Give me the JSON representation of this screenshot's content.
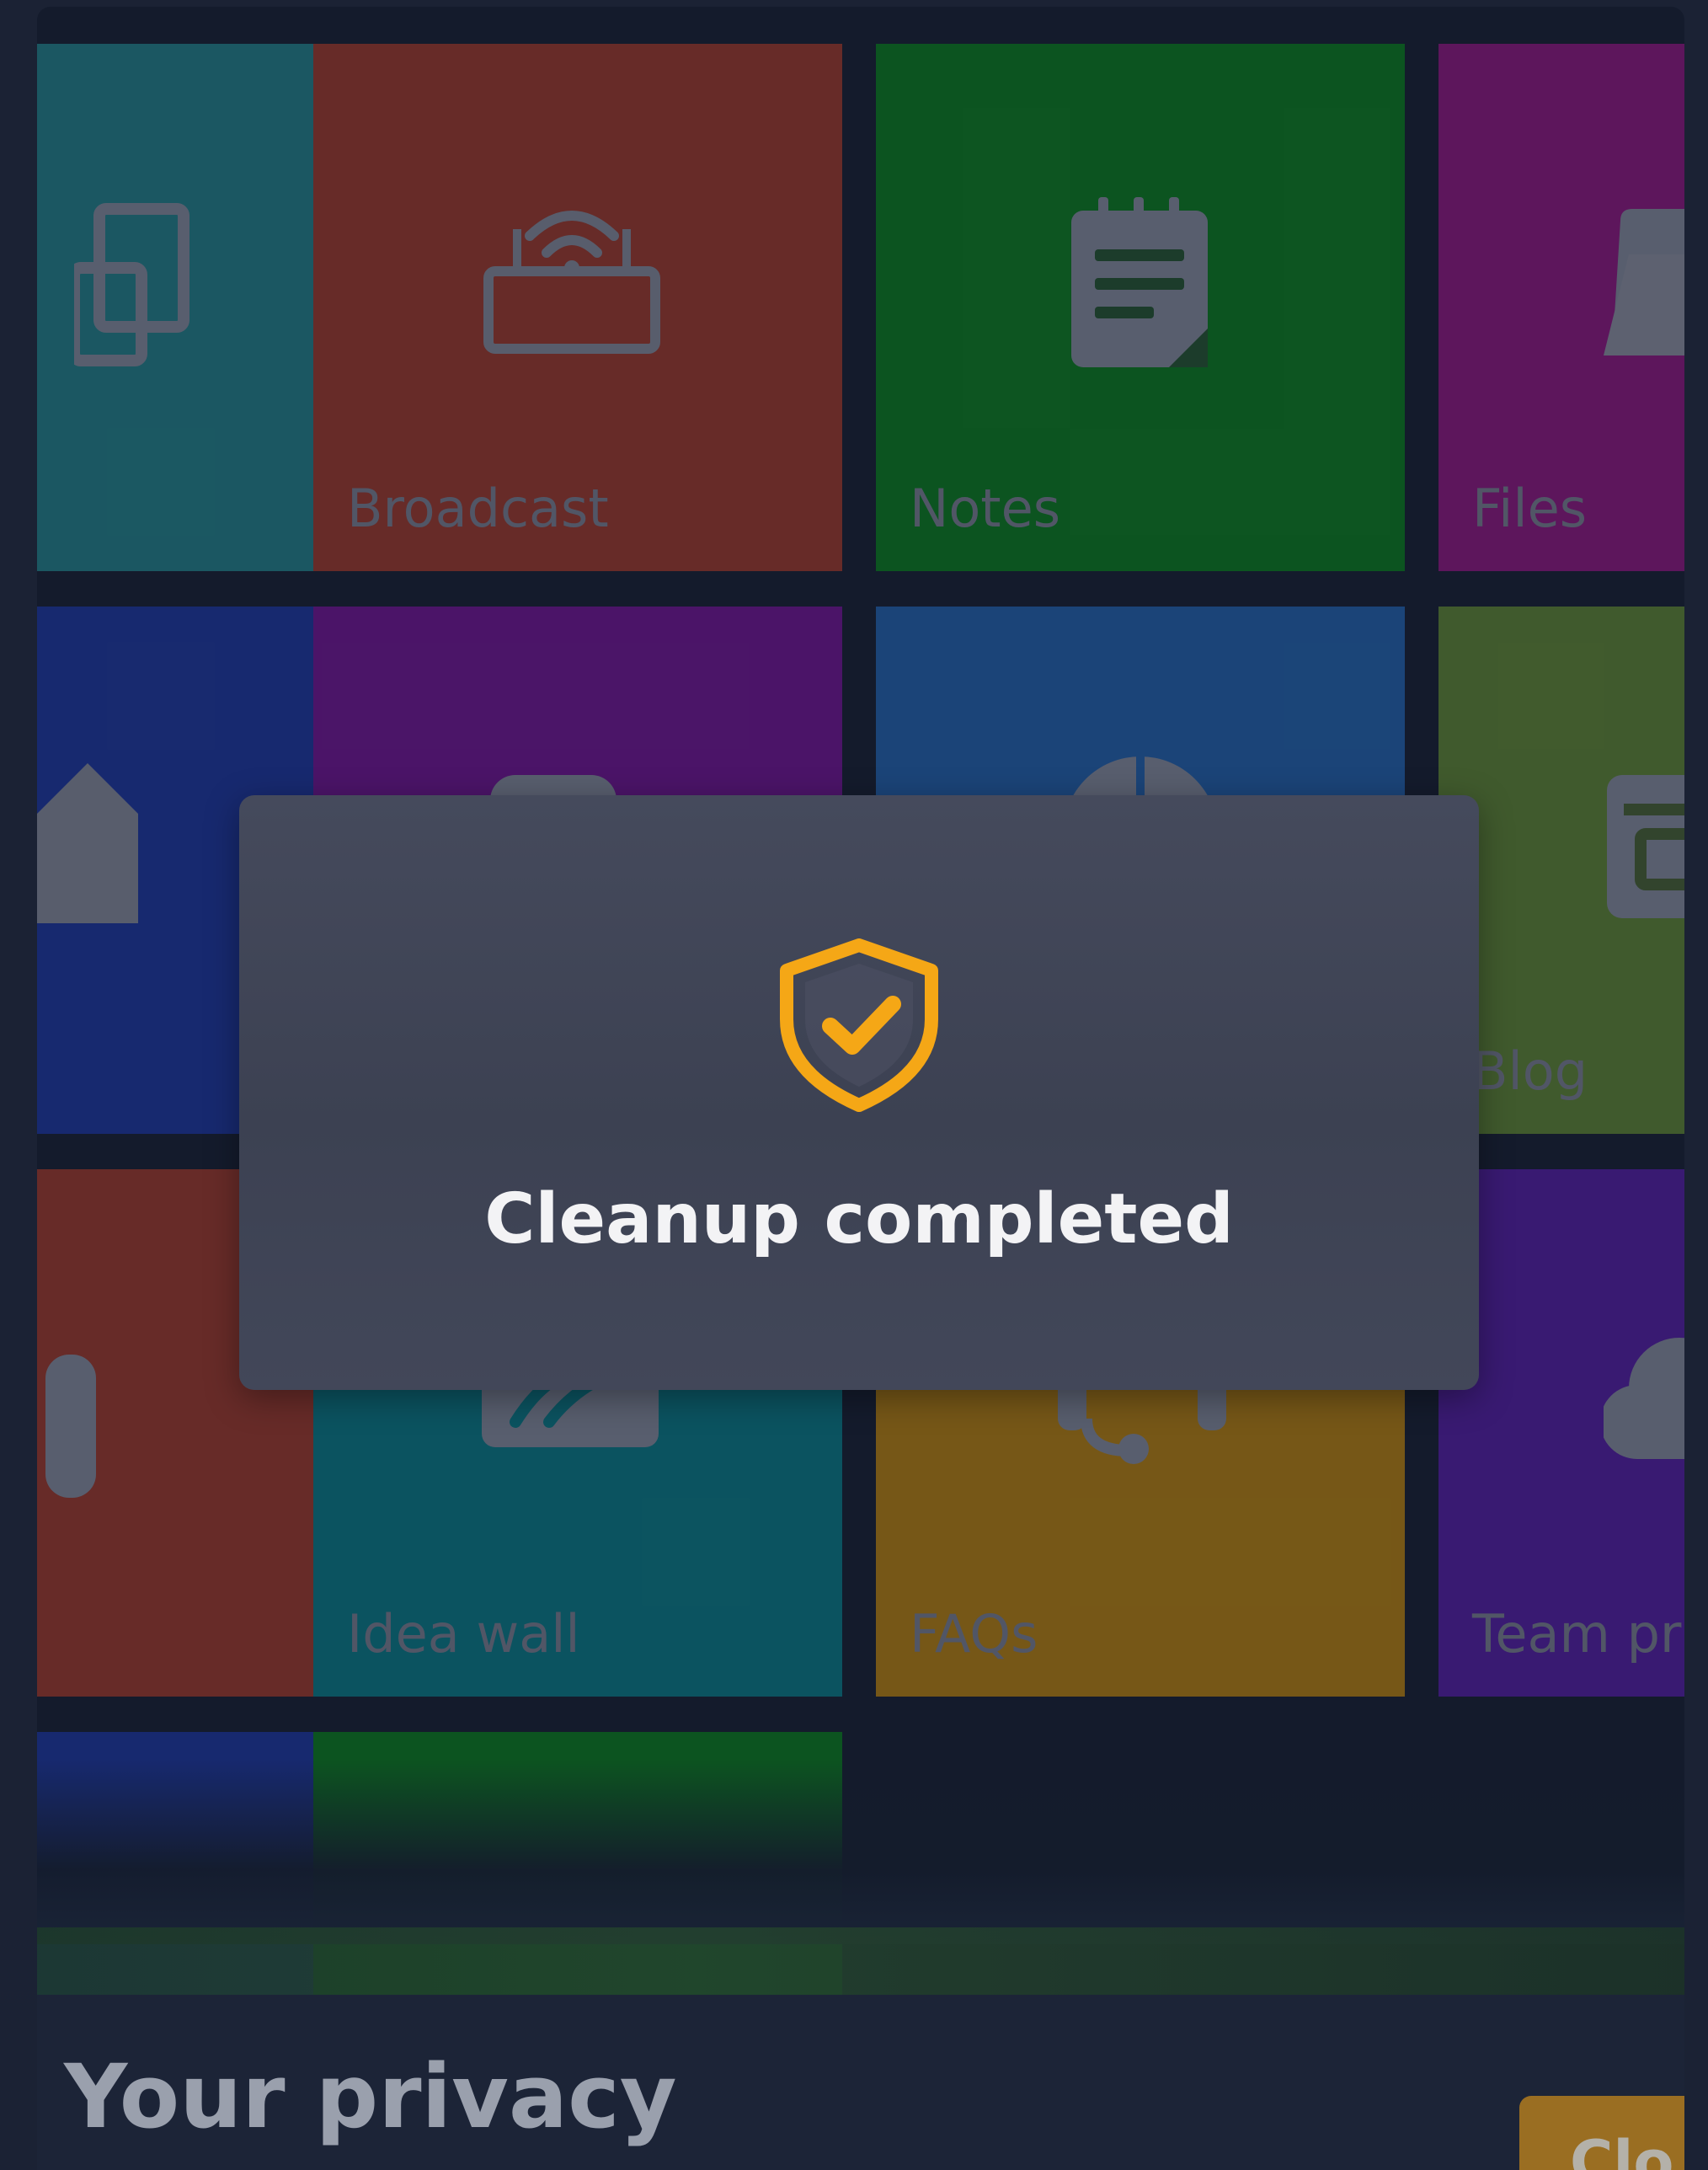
{
  "tiles": {
    "broadcast": {
      "label": "Broadcast",
      "color": "#c8452e"
    },
    "notes": {
      "label": "Notes",
      "color": "#0c9c1f"
    },
    "files": {
      "label": "Files",
      "color": "#b3199c"
    },
    "blog": {
      "label": "Blog",
      "color": "#78a83a"
    },
    "idea_wall": {
      "label": "Idea wall",
      "color": "#0a9aa4"
    },
    "faqs": {
      "label": "FAQs",
      "color": "#e8a20c"
    },
    "team": {
      "label": "Team pr",
      "color": "#6a22c8"
    }
  },
  "modal": {
    "icon": "shield-check-icon",
    "accent": "#f5a716",
    "title": "Cleanup completed"
  },
  "privacy": {
    "title": "Your privacy",
    "button_label": "Clo"
  }
}
